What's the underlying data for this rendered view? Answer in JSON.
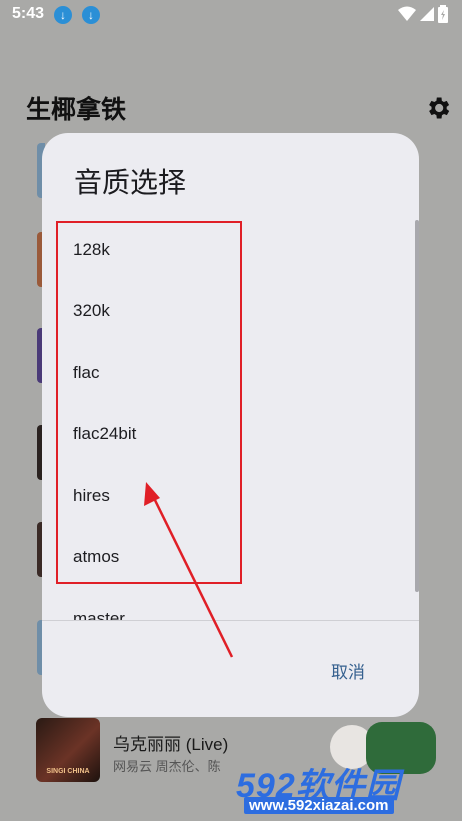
{
  "status_bar": {
    "time": "5:43"
  },
  "app": {
    "title": "生椰拿铁"
  },
  "dialog": {
    "title": "音质选择",
    "options": [
      "128k",
      "320k",
      "flac",
      "flac24bit",
      "hires",
      "atmos",
      "master"
    ],
    "cancel_label": "取消"
  },
  "list_item": {
    "title": "乌克丽丽 (Live)",
    "subtitle": "网易云 周杰伦、陈",
    "cover_text": "SINGI CHINA"
  },
  "watermark": {
    "brand": "592软件园",
    "url": "www.592xiazai.com"
  },
  "colors": {
    "accent": "#35608f",
    "highlight": "#e01f27",
    "watermark": "#2d6de0",
    "fab": "#2f6b3a"
  }
}
